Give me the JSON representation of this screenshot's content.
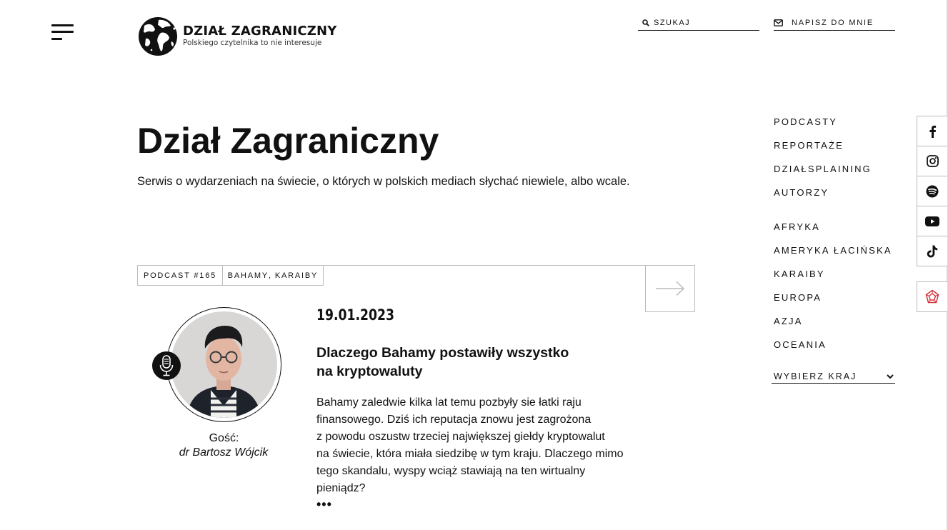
{
  "header": {
    "logo_title": "DZIAŁ ZAGRANICZNY",
    "logo_tagline": "Polskiego czytelnika to nie interesuje",
    "search_placeholder": "SZUKAJ",
    "write_label": "NAPISZ DO MNIE"
  },
  "hero": {
    "title": "Dział Zagraniczny",
    "subtitle": "Serwis o wydarzeniach na świecie, o których w polskich mediach słychać niewiele, albo wcale."
  },
  "nav": {
    "sections": [
      "PODCASTY",
      "REPORTAŻE",
      "DZIAŁSPLAINING",
      "AUTORZY"
    ],
    "regions": [
      "AFRYKA",
      "AMERYKA ŁACIŃSKA",
      "KARAIBY",
      "EUROPA",
      "AZJA",
      "OCEANIA"
    ],
    "country_select_value": "WYBIERZ KRAJ"
  },
  "social": [
    "facebook-icon",
    "instagram-icon",
    "spotify-icon",
    "youtube-icon",
    "tiktok-icon",
    "patronite-icon"
  ],
  "post": {
    "podcast_tag": "PODCAST #165",
    "categories": [
      "BAHAMY",
      "KARAIBY"
    ],
    "category_separator": ",",
    "date": "19.01.2023",
    "title_lines": [
      "Dlaczego Bahamy postawiły wszystko",
      "na kryptowaluty"
    ],
    "excerpt_lines": [
      "Bahamy zaledwie kilka lat temu pozbyły sie łatki raju",
      "finansowego. Dziś ich reputacja znowu jest zagrożona",
      "z powodu oszustw trzeciej największej giełdy kryptowalut",
      "na świecie, która miała siedzibę w tym kraju. Dlaczego mimo",
      "tego skandalu, wyspy wciąż stawiają na ten wirtualny",
      "pieniądz?"
    ],
    "more": "•••",
    "guest_label": "Gość:",
    "guest_name": "dr Bartosz Wójcik"
  },
  "colors": {
    "text": "#111111",
    "border": "#bbbbbb",
    "patronite": "#d0323a"
  }
}
